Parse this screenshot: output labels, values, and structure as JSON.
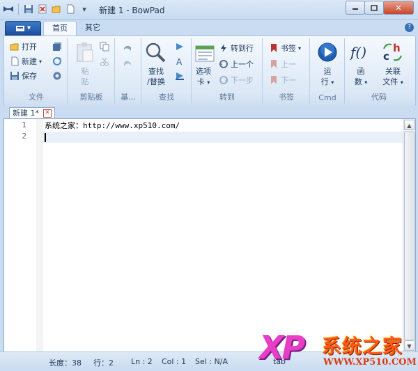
{
  "window": {
    "title": "新建 1 - BowPad"
  },
  "tabs": [
    {
      "label": "首页"
    },
    {
      "label": "其它"
    }
  ],
  "ribbon": {
    "file": {
      "open": "打开",
      "new": "新建",
      "save": "保存",
      "group": "文件"
    },
    "clipboard": {
      "paste_line1": "粘",
      "paste_line2": "贴",
      "group": "剪贴板"
    },
    "edit": {
      "group": "基..."
    },
    "find": {
      "find_line1": "查找",
      "find_line2": "/替换",
      "group": "查找"
    },
    "goto": {
      "tabs_line1": "选项",
      "tabs_line2": "卡",
      "goto_line": "转到行",
      "prev": "上一个",
      "next": "下一步",
      "group": "转到"
    },
    "bookmarks": {
      "bookmarks": "书签",
      "prev": "上一",
      "next": "下一",
      "group": "书签"
    },
    "cmd": {
      "run_line1": "运",
      "run_line2": "行",
      "group": "Cmd"
    },
    "code": {
      "func_line1": "函",
      "func_line2": "数",
      "assoc_line1": "关联",
      "assoc_line2": "文件",
      "group": "代码"
    }
  },
  "document": {
    "tab_label": "新建 1*",
    "lines": [
      {
        "num": "1",
        "text": "系统之家：http://www.xp510.com/"
      },
      {
        "num": "2",
        "text": ""
      }
    ]
  },
  "status": {
    "length": "长度：38",
    "lines": "行：2",
    "ln": "Ln : 2",
    "col": "Col : 1",
    "sel": "Sel : N/A",
    "tab": "tab"
  },
  "watermark": {
    "logo": "XP",
    "name": "系统之家",
    "url": "WWW.XP510.COM"
  },
  "colors": {
    "accent": "#1c4f9c",
    "ribbon_bg": "#dce8f6",
    "status_bg": "#c8dbf0"
  }
}
